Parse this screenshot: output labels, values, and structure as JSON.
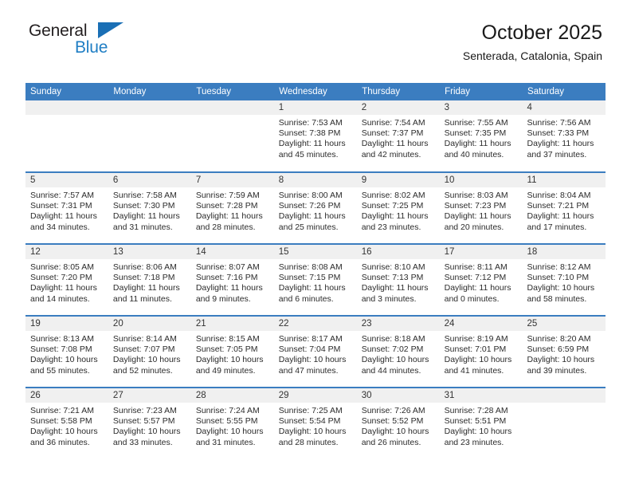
{
  "brand": {
    "name_top": "General",
    "name_bottom": "Blue",
    "colors": {
      "dark": "#231f20",
      "blue": "#1f7ec4",
      "triangle": "#1a6fb5"
    }
  },
  "header": {
    "title": "October 2025",
    "location": "Senterada, Catalonia, Spain"
  },
  "theme": {
    "header_row_bg": "#3b7dc0",
    "daynum_bg": "#f0f0f0",
    "separator": "#3b7dc0"
  },
  "weekday_headers": [
    "Sunday",
    "Monday",
    "Tuesday",
    "Wednesday",
    "Thursday",
    "Friday",
    "Saturday"
  ],
  "weeks": [
    [
      {
        "day": "",
        "sunrise": "",
        "sunset": "",
        "daylight1": "",
        "daylight2": ""
      },
      {
        "day": "",
        "sunrise": "",
        "sunset": "",
        "daylight1": "",
        "daylight2": ""
      },
      {
        "day": "",
        "sunrise": "",
        "sunset": "",
        "daylight1": "",
        "daylight2": ""
      },
      {
        "day": "1",
        "sunrise": "Sunrise: 7:53 AM",
        "sunset": "Sunset: 7:38 PM",
        "daylight1": "Daylight: 11 hours",
        "daylight2": "and 45 minutes."
      },
      {
        "day": "2",
        "sunrise": "Sunrise: 7:54 AM",
        "sunset": "Sunset: 7:37 PM",
        "daylight1": "Daylight: 11 hours",
        "daylight2": "and 42 minutes."
      },
      {
        "day": "3",
        "sunrise": "Sunrise: 7:55 AM",
        "sunset": "Sunset: 7:35 PM",
        "daylight1": "Daylight: 11 hours",
        "daylight2": "and 40 minutes."
      },
      {
        "day": "4",
        "sunrise": "Sunrise: 7:56 AM",
        "sunset": "Sunset: 7:33 PM",
        "daylight1": "Daylight: 11 hours",
        "daylight2": "and 37 minutes."
      }
    ],
    [
      {
        "day": "5",
        "sunrise": "Sunrise: 7:57 AM",
        "sunset": "Sunset: 7:31 PM",
        "daylight1": "Daylight: 11 hours",
        "daylight2": "and 34 minutes."
      },
      {
        "day": "6",
        "sunrise": "Sunrise: 7:58 AM",
        "sunset": "Sunset: 7:30 PM",
        "daylight1": "Daylight: 11 hours",
        "daylight2": "and 31 minutes."
      },
      {
        "day": "7",
        "sunrise": "Sunrise: 7:59 AM",
        "sunset": "Sunset: 7:28 PM",
        "daylight1": "Daylight: 11 hours",
        "daylight2": "and 28 minutes."
      },
      {
        "day": "8",
        "sunrise": "Sunrise: 8:00 AM",
        "sunset": "Sunset: 7:26 PM",
        "daylight1": "Daylight: 11 hours",
        "daylight2": "and 25 minutes."
      },
      {
        "day": "9",
        "sunrise": "Sunrise: 8:02 AM",
        "sunset": "Sunset: 7:25 PM",
        "daylight1": "Daylight: 11 hours",
        "daylight2": "and 23 minutes."
      },
      {
        "day": "10",
        "sunrise": "Sunrise: 8:03 AM",
        "sunset": "Sunset: 7:23 PM",
        "daylight1": "Daylight: 11 hours",
        "daylight2": "and 20 minutes."
      },
      {
        "day": "11",
        "sunrise": "Sunrise: 8:04 AM",
        "sunset": "Sunset: 7:21 PM",
        "daylight1": "Daylight: 11 hours",
        "daylight2": "and 17 minutes."
      }
    ],
    [
      {
        "day": "12",
        "sunrise": "Sunrise: 8:05 AM",
        "sunset": "Sunset: 7:20 PM",
        "daylight1": "Daylight: 11 hours",
        "daylight2": "and 14 minutes."
      },
      {
        "day": "13",
        "sunrise": "Sunrise: 8:06 AM",
        "sunset": "Sunset: 7:18 PM",
        "daylight1": "Daylight: 11 hours",
        "daylight2": "and 11 minutes."
      },
      {
        "day": "14",
        "sunrise": "Sunrise: 8:07 AM",
        "sunset": "Sunset: 7:16 PM",
        "daylight1": "Daylight: 11 hours",
        "daylight2": "and 9 minutes."
      },
      {
        "day": "15",
        "sunrise": "Sunrise: 8:08 AM",
        "sunset": "Sunset: 7:15 PM",
        "daylight1": "Daylight: 11 hours",
        "daylight2": "and 6 minutes."
      },
      {
        "day": "16",
        "sunrise": "Sunrise: 8:10 AM",
        "sunset": "Sunset: 7:13 PM",
        "daylight1": "Daylight: 11 hours",
        "daylight2": "and 3 minutes."
      },
      {
        "day": "17",
        "sunrise": "Sunrise: 8:11 AM",
        "sunset": "Sunset: 7:12 PM",
        "daylight1": "Daylight: 11 hours",
        "daylight2": "and 0 minutes."
      },
      {
        "day": "18",
        "sunrise": "Sunrise: 8:12 AM",
        "sunset": "Sunset: 7:10 PM",
        "daylight1": "Daylight: 10 hours",
        "daylight2": "and 58 minutes."
      }
    ],
    [
      {
        "day": "19",
        "sunrise": "Sunrise: 8:13 AM",
        "sunset": "Sunset: 7:08 PM",
        "daylight1": "Daylight: 10 hours",
        "daylight2": "and 55 minutes."
      },
      {
        "day": "20",
        "sunrise": "Sunrise: 8:14 AM",
        "sunset": "Sunset: 7:07 PM",
        "daylight1": "Daylight: 10 hours",
        "daylight2": "and 52 minutes."
      },
      {
        "day": "21",
        "sunrise": "Sunrise: 8:15 AM",
        "sunset": "Sunset: 7:05 PM",
        "daylight1": "Daylight: 10 hours",
        "daylight2": "and 49 minutes."
      },
      {
        "day": "22",
        "sunrise": "Sunrise: 8:17 AM",
        "sunset": "Sunset: 7:04 PM",
        "daylight1": "Daylight: 10 hours",
        "daylight2": "and 47 minutes."
      },
      {
        "day": "23",
        "sunrise": "Sunrise: 8:18 AM",
        "sunset": "Sunset: 7:02 PM",
        "daylight1": "Daylight: 10 hours",
        "daylight2": "and 44 minutes."
      },
      {
        "day": "24",
        "sunrise": "Sunrise: 8:19 AM",
        "sunset": "Sunset: 7:01 PM",
        "daylight1": "Daylight: 10 hours",
        "daylight2": "and 41 minutes."
      },
      {
        "day": "25",
        "sunrise": "Sunrise: 8:20 AM",
        "sunset": "Sunset: 6:59 PM",
        "daylight1": "Daylight: 10 hours",
        "daylight2": "and 39 minutes."
      }
    ],
    [
      {
        "day": "26",
        "sunrise": "Sunrise: 7:21 AM",
        "sunset": "Sunset: 5:58 PM",
        "daylight1": "Daylight: 10 hours",
        "daylight2": "and 36 minutes."
      },
      {
        "day": "27",
        "sunrise": "Sunrise: 7:23 AM",
        "sunset": "Sunset: 5:57 PM",
        "daylight1": "Daylight: 10 hours",
        "daylight2": "and 33 minutes."
      },
      {
        "day": "28",
        "sunrise": "Sunrise: 7:24 AM",
        "sunset": "Sunset: 5:55 PM",
        "daylight1": "Daylight: 10 hours",
        "daylight2": "and 31 minutes."
      },
      {
        "day": "29",
        "sunrise": "Sunrise: 7:25 AM",
        "sunset": "Sunset: 5:54 PM",
        "daylight1": "Daylight: 10 hours",
        "daylight2": "and 28 minutes."
      },
      {
        "day": "30",
        "sunrise": "Sunrise: 7:26 AM",
        "sunset": "Sunset: 5:52 PM",
        "daylight1": "Daylight: 10 hours",
        "daylight2": "and 26 minutes."
      },
      {
        "day": "31",
        "sunrise": "Sunrise: 7:28 AM",
        "sunset": "Sunset: 5:51 PM",
        "daylight1": "Daylight: 10 hours",
        "daylight2": "and 23 minutes."
      },
      {
        "day": "",
        "sunrise": "",
        "sunset": "",
        "daylight1": "",
        "daylight2": ""
      }
    ]
  ]
}
